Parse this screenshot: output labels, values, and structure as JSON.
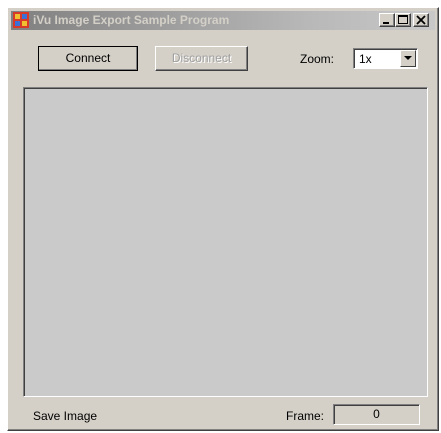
{
  "window": {
    "title": "iVu Image Export Sample Program"
  },
  "toolbar": {
    "connect_label": "Connect",
    "disconnect_label": "Disconnect",
    "zoom_label": "Zoom:",
    "zoom_value": "1x"
  },
  "status": {
    "save_image_label": "Save Image",
    "frame_label": "Frame:",
    "frame_value": "0"
  }
}
